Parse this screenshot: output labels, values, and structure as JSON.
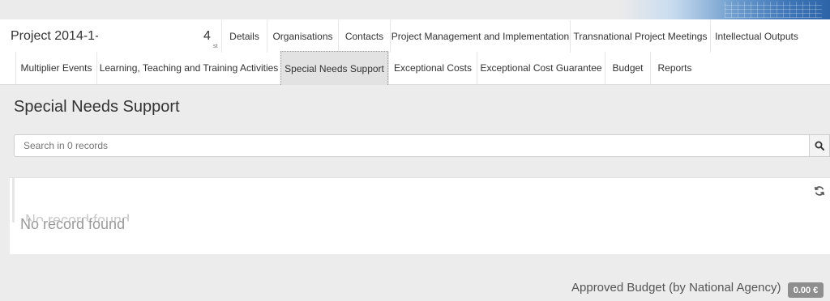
{
  "header": {
    "project_code_start": "Project 2014-1-",
    "project_code_end": "4",
    "project_code_suffix": "st"
  },
  "tabs_row1": [
    {
      "label": "Details"
    },
    {
      "label": "Organisations"
    },
    {
      "label": "Contacts"
    },
    {
      "label": "Project Management and Implementation"
    },
    {
      "label": "Transnational Project Meetings"
    },
    {
      "label": "Intellectual Outputs"
    }
  ],
  "tabs_row2": [
    {
      "label": "Multiplier Events"
    },
    {
      "label": "Learning, Teaching and Training Activities"
    },
    {
      "label": "Special Needs Support",
      "active": true
    },
    {
      "label": "Exceptional Costs"
    },
    {
      "label": "Exceptional Cost Guarantee"
    },
    {
      "label": "Budget"
    },
    {
      "label": "Reports"
    }
  ],
  "main": {
    "title": "Special Needs Support",
    "search": {
      "placeholder": "Search in 0 records",
      "value": ""
    },
    "results": {
      "empty_text": "No record found"
    },
    "footer": {
      "budget_label": "Approved Budget (by National Agency)",
      "budget_value": "0.00 €"
    }
  },
  "icons": {
    "search": "search-icon",
    "refresh": "refresh-icon"
  },
  "colors": {
    "active_tab_bg": "#e2e2e2",
    "badge_bg": "#8e8e8e",
    "page_bg": "#ececec"
  }
}
